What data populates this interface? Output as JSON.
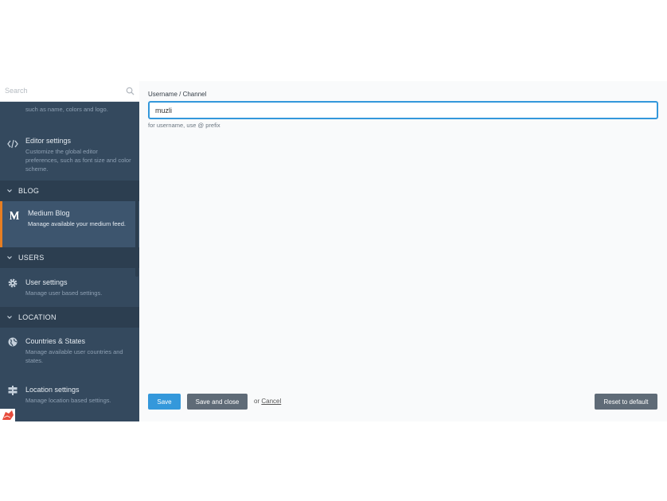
{
  "sidebar": {
    "search_placeholder": "Search",
    "items_top": [
      {
        "title": "",
        "desc": "such as name, colors and logo."
      },
      {
        "title": "Editor settings",
        "desc": "Customize the global editor preferences, such as font size and color scheme."
      }
    ],
    "sections": [
      {
        "label": "BLOG"
      },
      {
        "label": "USERS"
      },
      {
        "label": "LOCATION"
      }
    ],
    "blog_item": {
      "title": "Medium Blog",
      "desc": "Manage available your medium feed."
    },
    "users_item": {
      "title": "User settings",
      "desc": "Manage user based settings."
    },
    "location_items": [
      {
        "title": "Countries & States",
        "desc": "Manage available user countries and states."
      },
      {
        "title": "Location settings",
        "desc": "Manage location based settings."
      }
    ],
    "accent_color": "#e67e22"
  },
  "form": {
    "label": "Username / Channel",
    "value": "muzli",
    "help": "for username, use @ prefix"
  },
  "actions": {
    "save": "Save",
    "save_close": "Save and close",
    "or": "or",
    "cancel": "Cancel",
    "reset": "Reset to default"
  },
  "colors": {
    "primary": "#3498db",
    "sidebar": "#34495e",
    "secondary_button": "#5f6b77"
  }
}
